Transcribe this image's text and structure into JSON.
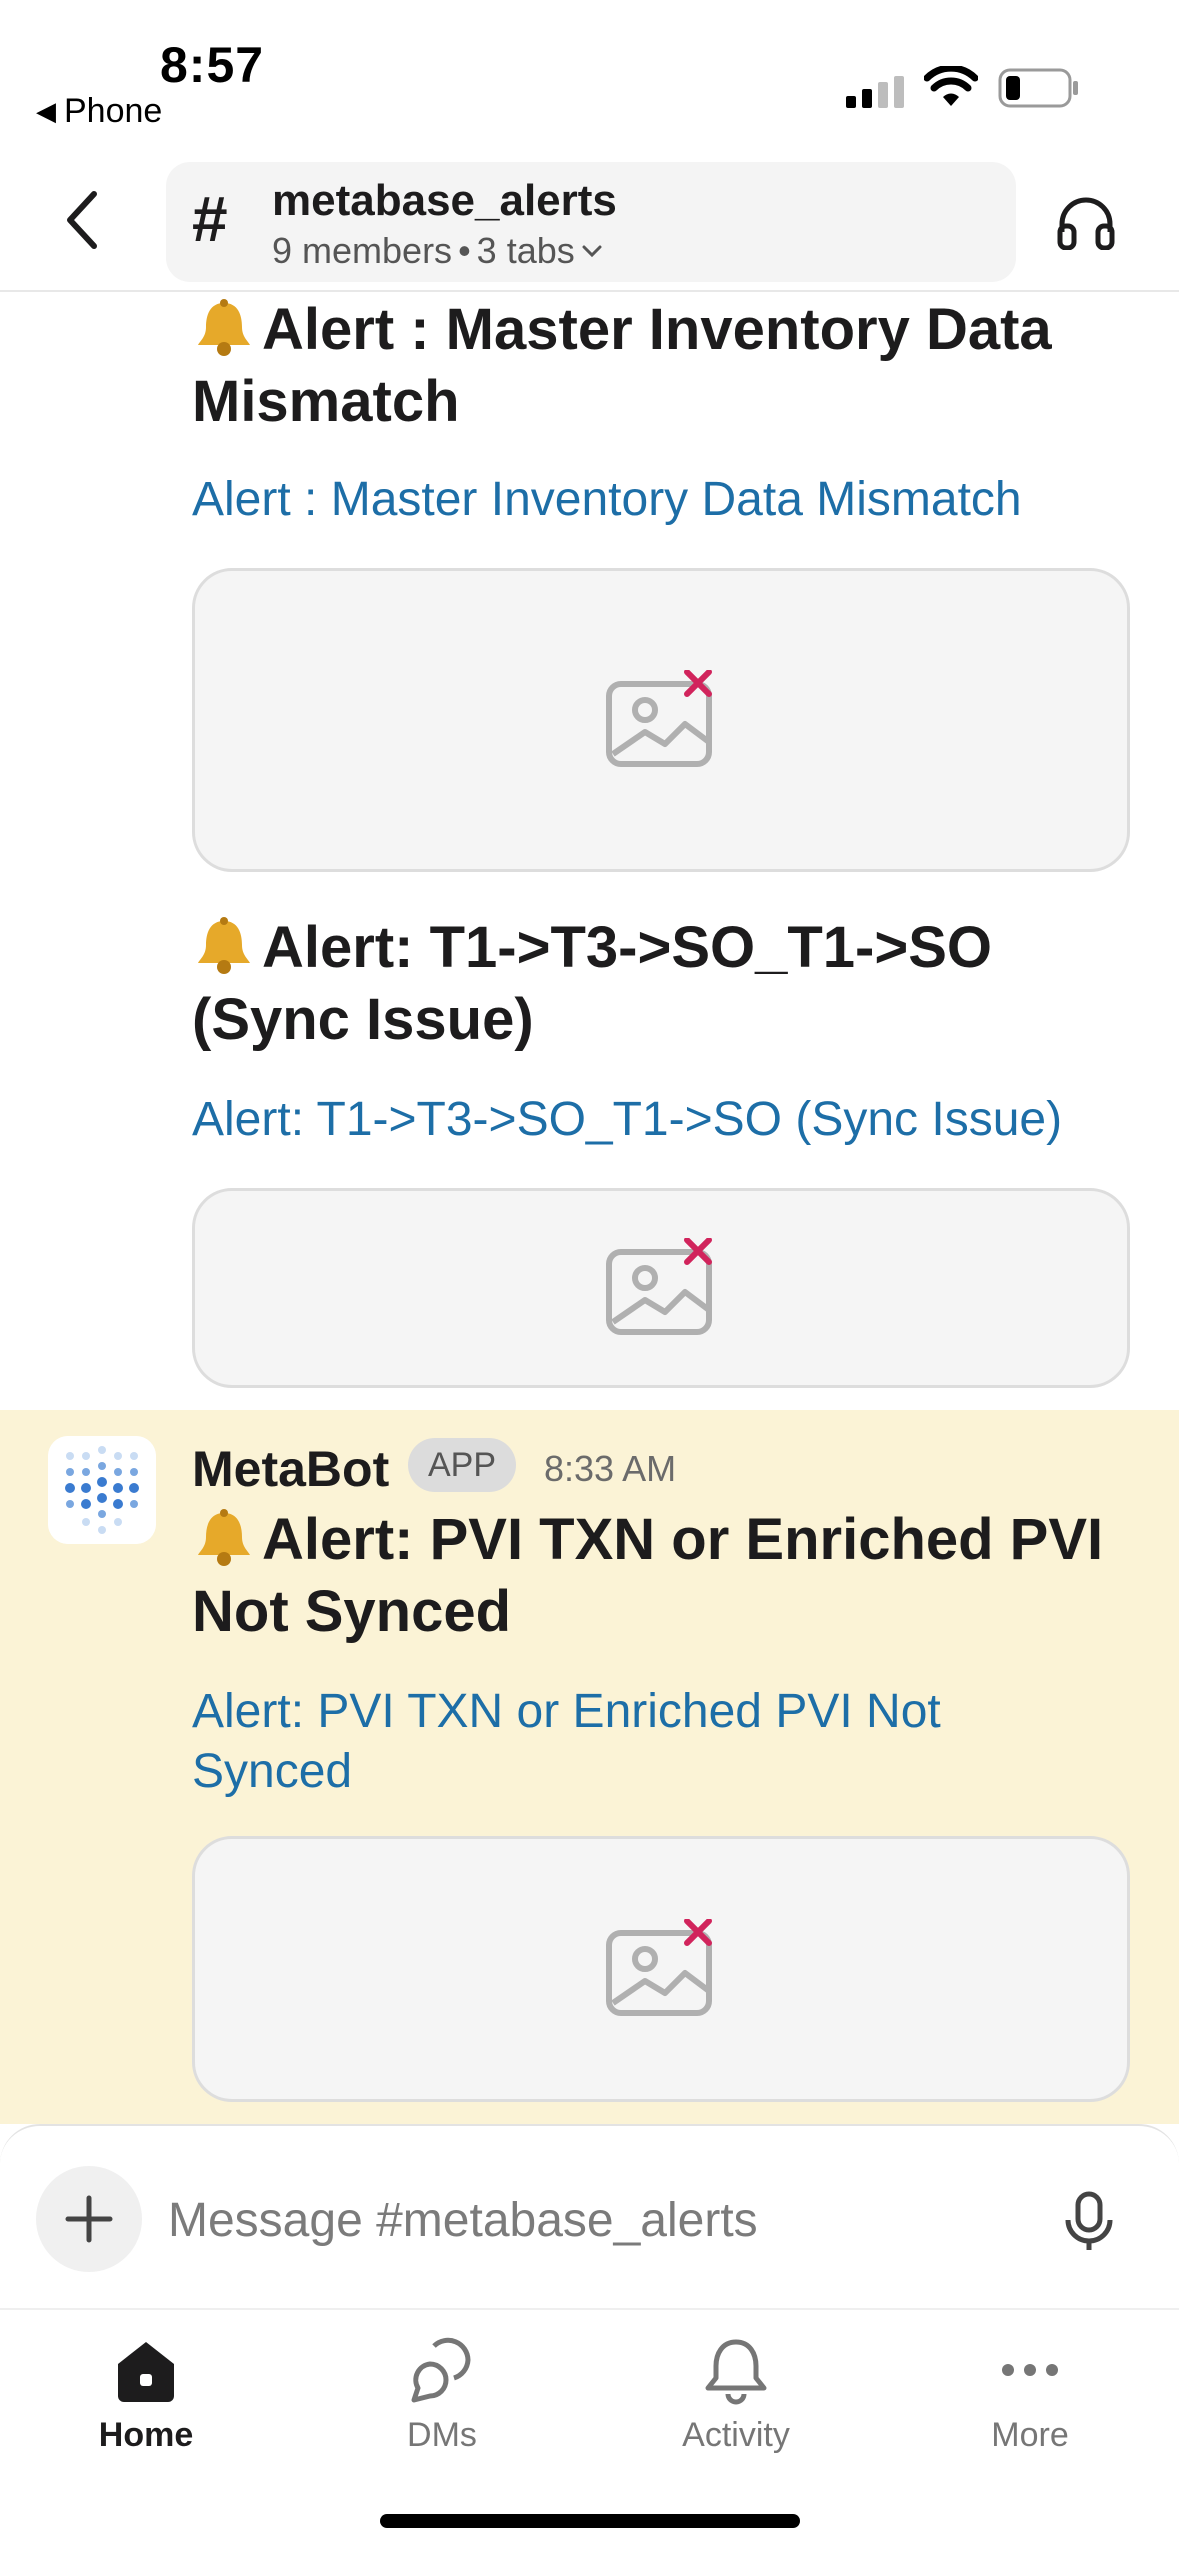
{
  "status_bar": {
    "time": "8:57",
    "back_app": "Phone",
    "battery_level": 0.2
  },
  "channel": {
    "name": "metabase_alerts",
    "members": "9 members",
    "separator": "•",
    "tabs": "3 tabs"
  },
  "messages": [
    {
      "title": "Alert : Master Inventory Data Mismatch",
      "link": "Alert : Master Inventory Data Mismatch"
    },
    {
      "title": "Alert: T1->T3->SO_T1->SO (Sync Issue)",
      "link": "Alert: T1->T3->SO_T1->SO (Sync Issue)"
    },
    {
      "sender": "MetaBot",
      "badge": "APP",
      "time": "8:33 AM",
      "title": "Alert: PVI TXN or Enriched PVI Not Synced",
      "link": "Alert: PVI TXN or Enriched PVI Not Synced"
    }
  ],
  "composer": {
    "placeholder": "Message #metabase_alerts"
  },
  "tabbar": [
    {
      "label": "Home",
      "icon": "home-icon",
      "active": true
    },
    {
      "label": "DMs",
      "icon": "dms-icon",
      "active": false
    },
    {
      "label": "Activity",
      "icon": "bell-icon",
      "active": false
    },
    {
      "label": "More",
      "icon": "more-icon",
      "active": false
    }
  ],
  "colors": {
    "link": "#1d6ea7",
    "highlight": "#fbf3d6",
    "broken_image_x": "#d1245c"
  }
}
